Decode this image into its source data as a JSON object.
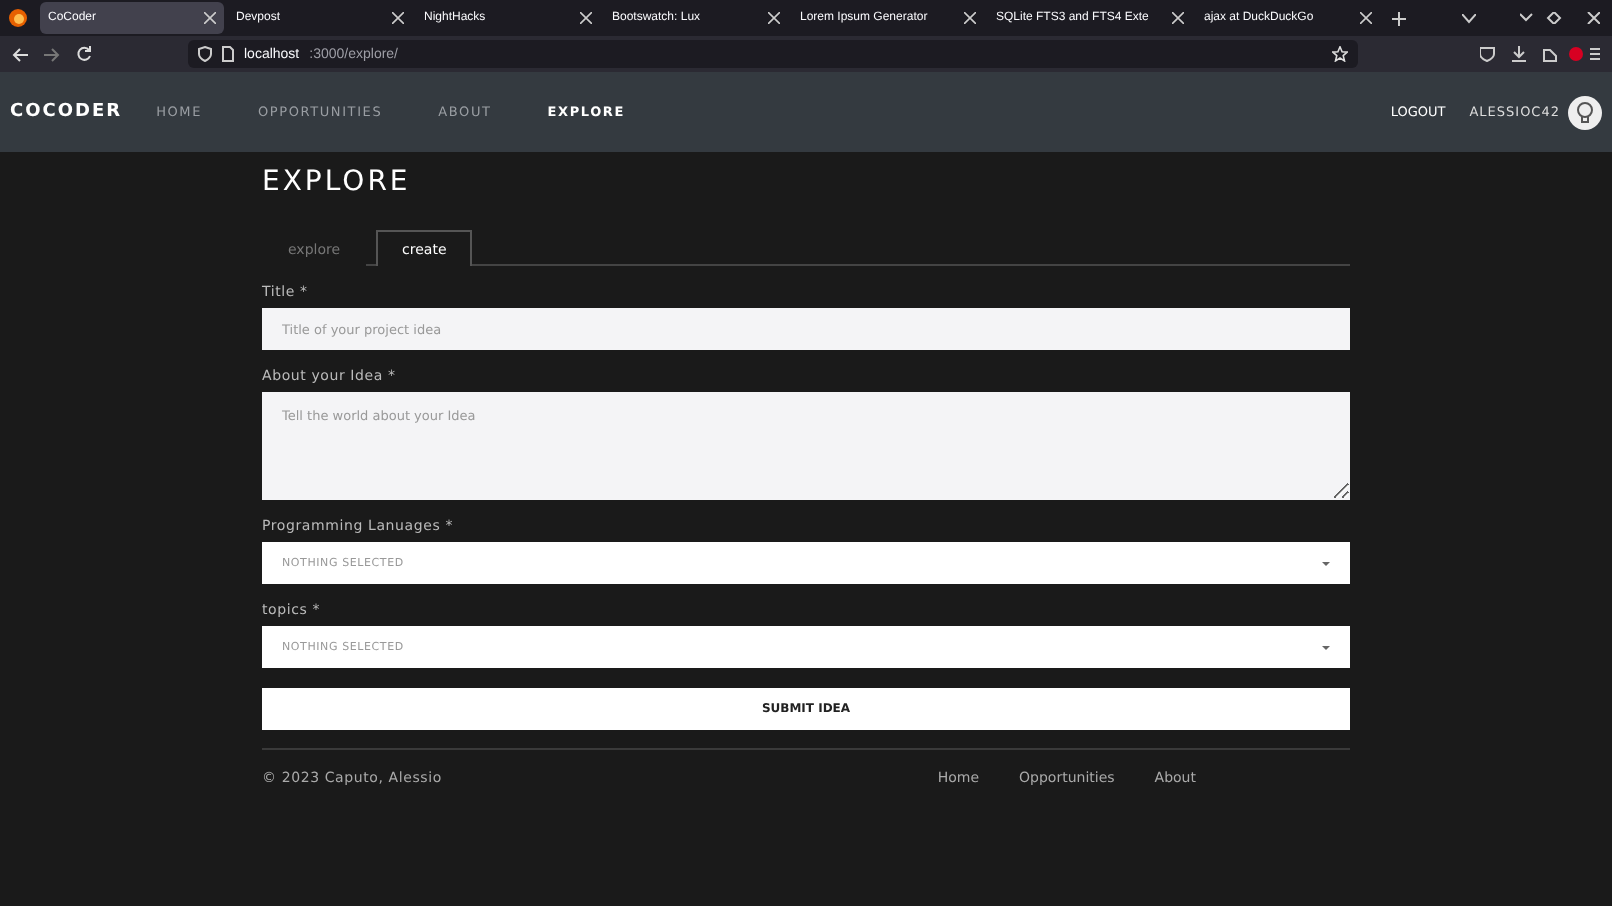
{
  "browser": {
    "tabs": [
      {
        "title": "CoCoder",
        "selected": true
      },
      {
        "title": "Devpost",
        "selected": false
      },
      {
        "title": "NightHacks",
        "selected": false
      },
      {
        "title": "Bootswatch: Lux",
        "selected": false
      },
      {
        "title": "Lorem Ipsum Generator",
        "selected": false
      },
      {
        "title": "SQLite FTS3 and FTS4 Exte",
        "selected": false
      },
      {
        "title": "ajax at DuckDuckGo",
        "selected": false
      }
    ],
    "url_host": "localhost",
    "url_path": ":3000/explore/"
  },
  "navbar": {
    "brand": "COCODER",
    "items": [
      {
        "label": "HOME",
        "selected": false
      },
      {
        "label": "OPPORTUNITIES",
        "selected": false
      },
      {
        "label": "ABOUT",
        "selected": false
      },
      {
        "label": "EXPLORE",
        "selected": true
      }
    ],
    "logout": "LOGOUT",
    "username": "ALESSIOC42"
  },
  "page": {
    "title": "EXPLORE",
    "tabs": [
      {
        "label": "explore",
        "selected": false
      },
      {
        "label": "create",
        "selected": true
      }
    ],
    "form": {
      "fields": [
        {
          "kind": "input",
          "label": "Title",
          "required": "*",
          "placeholder": "Title of your project idea"
        },
        {
          "kind": "textarea",
          "label": "About your Idea",
          "required": "*",
          "placeholder": "Tell the world about your Idea"
        },
        {
          "kind": "select",
          "label": "Programming Lanuages",
          "required": "*",
          "value": "NOTHING SELECTED"
        },
        {
          "kind": "select",
          "label": "topics",
          "required": "*",
          "value": "NOTHING SELECTED"
        }
      ],
      "submit": "SUBMIT IDEA"
    }
  },
  "footer": {
    "copyright": "© 2023 Caputo, Alessio",
    "links": [
      "Home",
      "Opportunities",
      "About"
    ]
  }
}
